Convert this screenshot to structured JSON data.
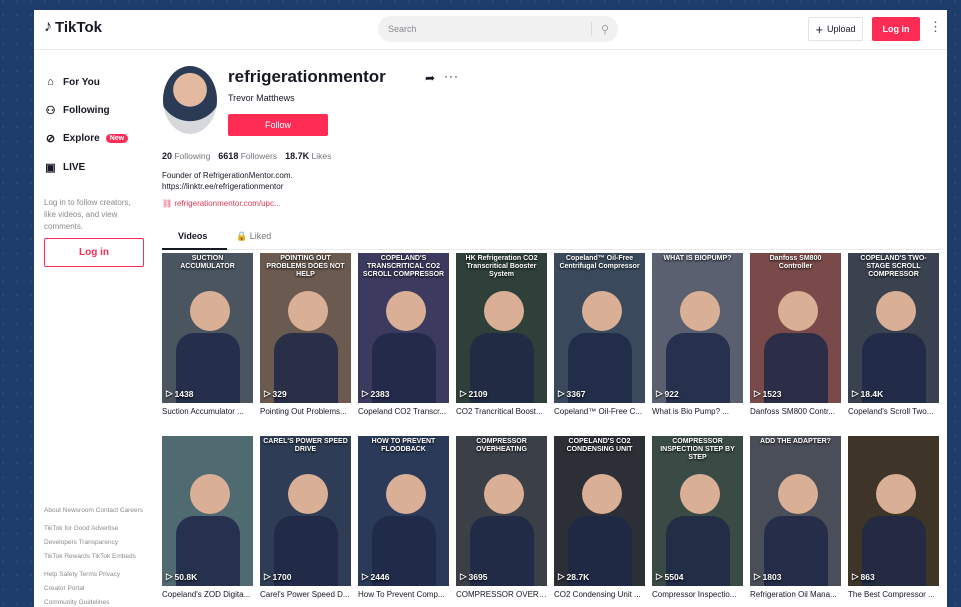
{
  "header": {
    "logo_text": "TikTok",
    "search_placeholder": "Search",
    "upload_label": "Upload",
    "login_label": "Log in"
  },
  "sidebar": {
    "items": [
      {
        "label": "For You",
        "icon": "home-icon"
      },
      {
        "label": "Following",
        "icon": "people-icon"
      },
      {
        "label": "Explore",
        "icon": "compass-icon",
        "badge": "New"
      },
      {
        "label": "LIVE",
        "icon": "live-icon"
      }
    ],
    "hint": "Log in to follow creators, like videos, and view comments.",
    "login_label": "Log in",
    "footer": [
      "About  Newsroom  Contact  Careers",
      "TikTok for Good  Advertise",
      "Developers  Transparency",
      "TikTok Rewards  TikTok Embeds",
      "Help  Safety  Terms  Privacy",
      "Creator Portal",
      "Community Guidelines"
    ]
  },
  "profile": {
    "username": "refrigerationmentor",
    "full_name": "Trevor Matthews",
    "follow_label": "Follow",
    "following_count": "20",
    "following_label": "Following",
    "followers_count": "6618",
    "followers_label": "Followers",
    "likes_count": "18.7K",
    "likes_label": "Likes",
    "bio_line1": "Founder of RefrigerationMentor.com.",
    "bio_line2": "https://linktr.ee/refrigerationmentor",
    "link": "refrigerationmentor.com/upc..."
  },
  "tabs": {
    "videos": "Videos",
    "liked": "Liked"
  },
  "videos": [
    {
      "caption": "SUCTION ACCUMULATOR",
      "views": "1438",
      "title": "Suction Accumulator ...",
      "bg": "#4a5560"
    },
    {
      "caption": "POINTING OUT PROBLEMS DOES NOT HELP",
      "views": "329",
      "title": "Pointing Out Problems...",
      "bg": "#6a5a50"
    },
    {
      "caption": "COPELAND'S TRANSCRITICAL CO2 SCROLL COMPRESSOR",
      "views": "2383",
      "title": "Copeland CO2 Transcr...",
      "bg": "#3c3a5e"
    },
    {
      "caption": "HK Refrigeration CO2 Transcritical Booster System",
      "views": "2109",
      "title": "CO2 Trancritical Boost...",
      "bg": "#2f3f3a"
    },
    {
      "caption": "Copeland™ Oil-Free Centrifugal Compressor",
      "views": "3367",
      "title": "Copeland™ Oil-Free C...",
      "bg": "#3a4a5c"
    },
    {
      "caption": "WHAT IS BIOPUMP?",
      "views": "922",
      "title": "What is Bio Pump? ...",
      "bg": "#5a6070"
    },
    {
      "caption": "Danfoss SM800 Controller",
      "views": "1523",
      "title": "Danfoss SM800 Contr...",
      "bg": "#7a4a4a"
    },
    {
      "caption": "COPELAND'S TWO-STAGE SCROLL COMPRESSOR",
      "views": "18.4K",
      "title": "Copeland's Scroll Two...",
      "bg": "#3a4250"
    },
    {
      "caption": "",
      "views": "50.8K",
      "title": "Copeland's ZOD Digita...",
      "bg": "#4f6a70"
    },
    {
      "caption": "CAREL'S POWER SPEED DRIVE",
      "views": "1700",
      "title": "Carel's Power Speed D...",
      "bg": "#2e3d55"
    },
    {
      "caption": "HOW TO PREVENT FLOODBACK",
      "views": "2446",
      "title": "How To Prevent Comp...",
      "bg": "#2a3a58"
    },
    {
      "caption": "COMPRESSOR OVERHEATING",
      "views": "3695",
      "title": "COMPRESSOR OVERH...",
      "bg": "#3a3f48"
    },
    {
      "caption": "COPELAND'S CO2 CONDENSING UNIT",
      "views": "28.7K",
      "title": "CO2 Condensing Unit ...",
      "bg": "#2c2f36"
    },
    {
      "caption": "COMPRESSOR INSPECTION STEP BY STEP",
      "views": "5504",
      "title": "Compressor Inspectio...",
      "bg": "#3a4a44"
    },
    {
      "caption": "ADD THE ADAPTER?",
      "views": "1803",
      "title": "Refrigeration Oil Mana...",
      "bg": "#4a4e58"
    },
    {
      "caption": "",
      "views": "863",
      "title": "The Best Compressor ...",
      "bg": "#3e3528"
    }
  ],
  "colors": {
    "brand": "#fe2c55",
    "text": "#161823",
    "muted": "#75767c"
  }
}
